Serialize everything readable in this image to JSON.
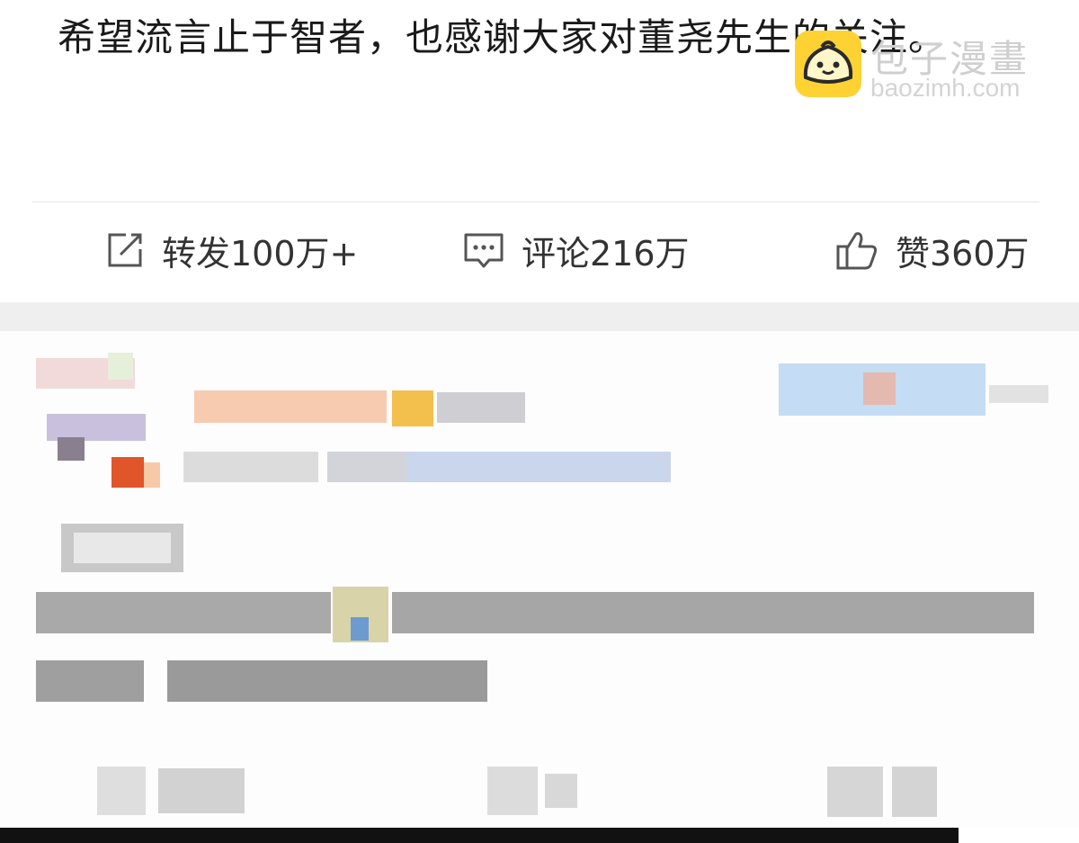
{
  "post": {
    "text": "希望流言止于智者，也感谢大家对董尧先生的关注。"
  },
  "watermark": {
    "name": "包子漫畫",
    "domain": "baozimh.com"
  },
  "actions": {
    "repost_label": "转发100万+",
    "comment_label": "评论216万",
    "like_label": "赞360万"
  },
  "icons": [
    "repost-icon",
    "comment-icon",
    "like-icon",
    "baozi-logo-icon"
  ],
  "colors": {
    "text": "#1a1a1a",
    "icon": "#555555",
    "divider": "#e6e6e6",
    "band": "#efefef",
    "logo": "#ffd233"
  }
}
